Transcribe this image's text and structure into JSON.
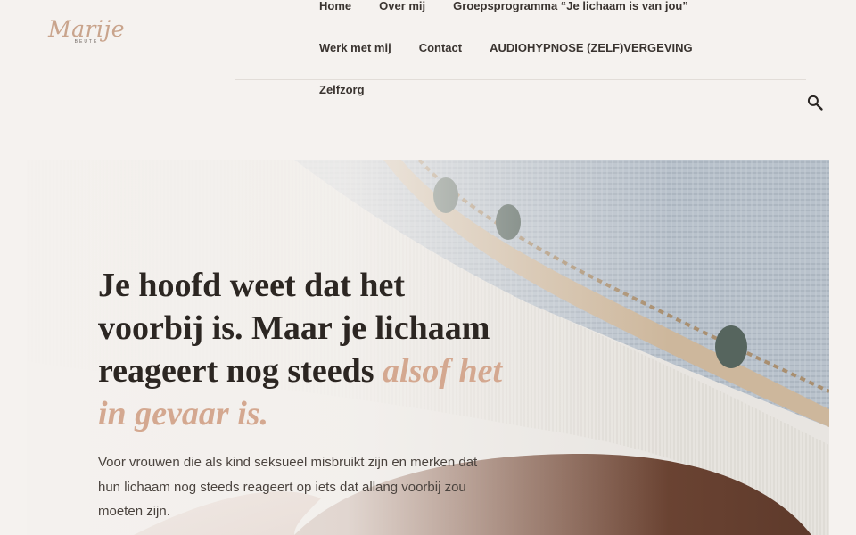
{
  "logo": {
    "name": "Marije",
    "subtitle": "BEUTE"
  },
  "nav": {
    "row1": [
      "Home",
      "Over mij",
      "Groepsprogramma “Je lichaam is van jou”"
    ],
    "row2": [
      "Werk met mij",
      "Contact",
      "AUDIOHYPNOSE (ZELF)VERGEVING"
    ],
    "row3": [
      "Zelfzorg"
    ]
  },
  "search": {
    "icon": "search-icon"
  },
  "hero": {
    "title_main": "Je hoofd weet dat het voorbij is. Maar je lichaam reageert nog steeds ",
    "title_accent": "alsof het in gevaar is.",
    "text": "Voor vrouwen die als kind seksueel misbruikt zijn en merken dat hun lichaam nog steeds reageert op iets dat allang voorbij zou moeten zijn."
  },
  "colors": {
    "background": "#f5f2ef",
    "accent": "#d4a890",
    "logo": "#c9a48c"
  }
}
